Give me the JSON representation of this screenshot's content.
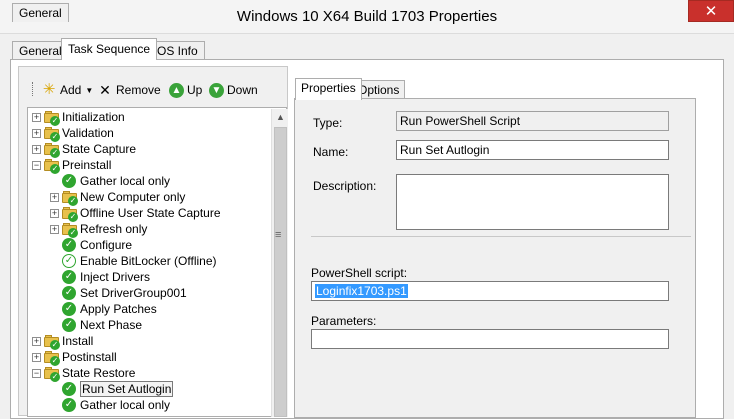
{
  "window": {
    "title": "Windows 10 X64 Build 1703 Properties",
    "close_glyph": "✕"
  },
  "tabs": [
    {
      "label": "General"
    },
    {
      "label": "Task Sequence"
    },
    {
      "label": "OS Info"
    }
  ],
  "toolbar": {
    "add_label": "Add",
    "remove_label": "Remove",
    "up_label": "Up",
    "down_label": "Down"
  },
  "tree": [
    {
      "label": "Initialization",
      "level": 0,
      "type": "group",
      "expanded": false
    },
    {
      "label": "Validation",
      "level": 0,
      "type": "group",
      "expanded": false
    },
    {
      "label": "State Capture",
      "level": 0,
      "type": "group",
      "expanded": false
    },
    {
      "label": "Preinstall",
      "level": 0,
      "type": "group",
      "expanded": true
    },
    {
      "label": "Gather local only",
      "level": 1,
      "type": "step"
    },
    {
      "label": "New Computer only",
      "level": 1,
      "type": "group",
      "expanded": false
    },
    {
      "label": "Offline User State Capture",
      "level": 1,
      "type": "group",
      "expanded": false
    },
    {
      "label": "Refresh only",
      "level": 1,
      "type": "group",
      "expanded": false
    },
    {
      "label": "Configure",
      "level": 1,
      "type": "step"
    },
    {
      "label": "Enable BitLocker (Offline)",
      "level": 1,
      "type": "step-outline"
    },
    {
      "label": "Inject Drivers",
      "level": 1,
      "type": "step"
    },
    {
      "label": "Set DriverGroup001",
      "level": 1,
      "type": "step"
    },
    {
      "label": "Apply Patches",
      "level": 1,
      "type": "step"
    },
    {
      "label": "Next Phase",
      "level": 1,
      "type": "step"
    },
    {
      "label": "Install",
      "level": 0,
      "type": "group",
      "expanded": false
    },
    {
      "label": "Postinstall",
      "level": 0,
      "type": "group",
      "expanded": false
    },
    {
      "label": "State Restore",
      "level": 0,
      "type": "group",
      "expanded": true
    },
    {
      "label": "Run Set Autlogin",
      "level": 1,
      "type": "step",
      "selected": true
    },
    {
      "label": "Gather local only",
      "level": 1,
      "type": "step"
    }
  ],
  "right_tabs": [
    {
      "label": "Properties"
    },
    {
      "label": "Options"
    }
  ],
  "properties": {
    "type_label": "Type:",
    "type_value": "Run PowerShell Script",
    "name_label": "Name:",
    "name_value": "Run Set Autlogin",
    "description_label": "Description:",
    "description_value": "",
    "script_label": "PowerShell script:",
    "script_value": "Loginfix1703.ps1",
    "parameters_label": "Parameters:",
    "parameters_value": ""
  }
}
